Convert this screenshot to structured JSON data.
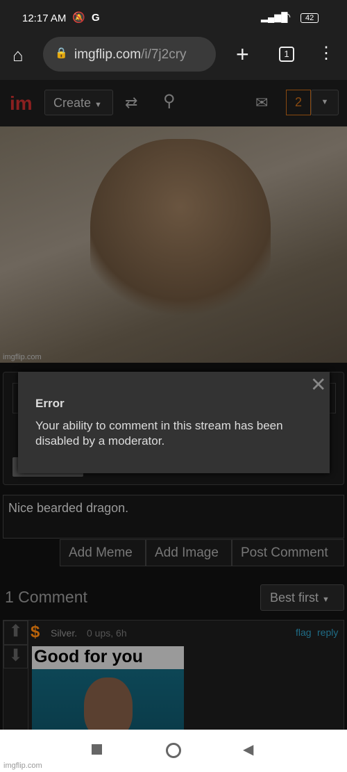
{
  "status_bar": {
    "time": "12:17 AM",
    "carrier_icon": "G",
    "battery": "42"
  },
  "browser": {
    "url_domain": "imgflip.com",
    "url_path": "/i/7j2cry",
    "tab_count": "1"
  },
  "site_header": {
    "logo": "im",
    "create_label": "Create",
    "notification_count": "2"
  },
  "image": {
    "watermark": "imgflip.com"
  },
  "error_dialog": {
    "title": "Error",
    "message": "Your ability to comment in this stream has been disabled by a moderator."
  },
  "comment_form": {
    "value": "Nice bearded dragon.",
    "add_meme": "Add Meme",
    "add_image": "Add Image",
    "post_comment": "Post Comment"
  },
  "comments": {
    "count_label": "1 Comment",
    "sort": "Best first",
    "items": [
      {
        "user": "Silver.",
        "meta": "0 ups, 6h",
        "flag": "flag",
        "reply": "reply",
        "meme_text": "Good for you"
      }
    ]
  },
  "footer_watermark": "imgflip.com",
  "colors": {
    "accent": "#c03030",
    "orange": "#b8620a",
    "link": "#1f6c86"
  }
}
